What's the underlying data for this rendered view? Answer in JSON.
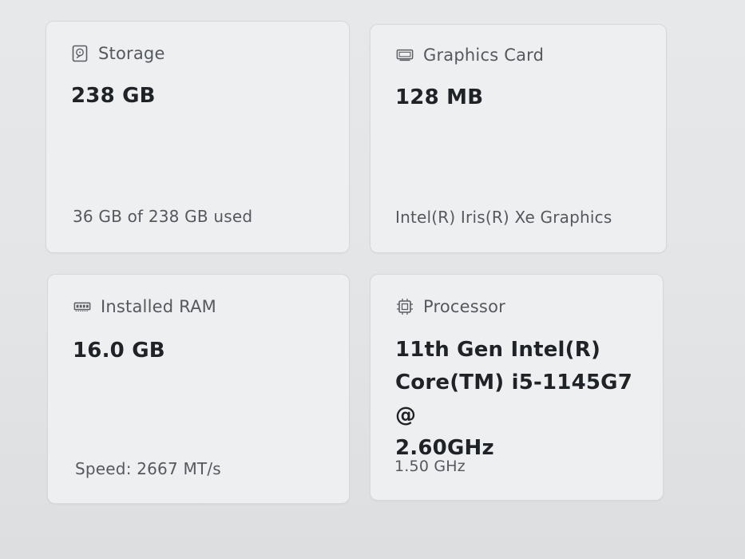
{
  "cards": {
    "storage": {
      "icon": "hard-drive-icon",
      "title": "Storage",
      "value": "238 GB",
      "detail": "36 GB of 238 GB used"
    },
    "graphics": {
      "icon": "graphics-card-icon",
      "title": "Graphics Card",
      "value": "128 MB",
      "detail": "Intel(R) Iris(R) Xe Graphics"
    },
    "ram": {
      "icon": "ram-module-icon",
      "title": "Installed RAM",
      "value": "16.0 GB",
      "detail": "Speed: 2667 MT/s"
    },
    "processor": {
      "icon": "processor-chip-icon",
      "title": "Processor",
      "value_lines": [
        "11th Gen Intel(R)",
        "Core(TM) i5-1145G7 @",
        "2.60GHz"
      ],
      "detail": "1.50 GHz"
    }
  },
  "colors": {
    "background": "#e4e6e8",
    "card": "#eeeff1",
    "card_border": "#d6d8db",
    "title_text": "#55595e",
    "value_text": "#1f2226"
  }
}
